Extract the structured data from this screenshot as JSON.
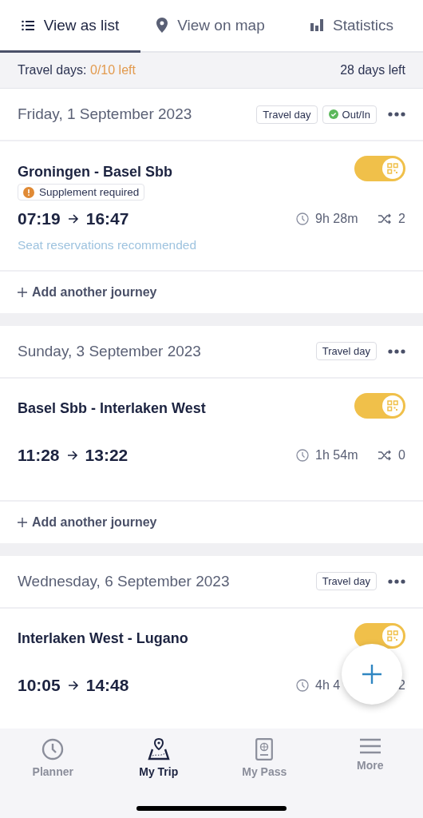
{
  "tabs": [
    {
      "label": "View as list",
      "selected": true
    },
    {
      "label": "View on map",
      "selected": false
    },
    {
      "label": "Statistics",
      "selected": false
    }
  ],
  "summary": {
    "label": "Travel days:",
    "value": "0/10 left",
    "right": "28 days left"
  },
  "days": [
    {
      "date": "Friday, 1 September 2023",
      "tags": [
        {
          "kind": "plain",
          "label": "Travel day"
        },
        {
          "kind": "check",
          "label": "Out/In"
        }
      ],
      "journeys": [
        {
          "route": "Groningen - Basel Sbb",
          "toggle_on": true,
          "supplement": "Supplement required",
          "depart": "07:19",
          "arrive": "16:47",
          "duration": "9h 28m",
          "transfers": "2",
          "note": "Seat reservations recommended"
        }
      ],
      "add_label": "Add another journey"
    },
    {
      "date": "Sunday, 3 September 2023",
      "tags": [
        {
          "kind": "plain",
          "label": "Travel day"
        }
      ],
      "journeys": [
        {
          "route": "Basel Sbb - Interlaken West",
          "toggle_on": true,
          "depart": "11:28",
          "arrive": "13:22",
          "duration": "1h 54m",
          "transfers": "0"
        }
      ],
      "add_label": "Add another journey"
    },
    {
      "date": "Wednesday, 6 September 2023",
      "tags": [
        {
          "kind": "plain",
          "label": "Travel day"
        }
      ],
      "journeys": [
        {
          "route": "Interlaken West - Lugano",
          "toggle_on": true,
          "depart": "10:05",
          "arrive": "14:48",
          "duration": "4h 4",
          "transfers": "2"
        }
      ]
    }
  ],
  "nav": [
    {
      "label": "Planner",
      "selected": false
    },
    {
      "label": "My Trip",
      "selected": true
    },
    {
      "label": "My Pass",
      "selected": false
    },
    {
      "label": "More",
      "selected": false
    }
  ]
}
